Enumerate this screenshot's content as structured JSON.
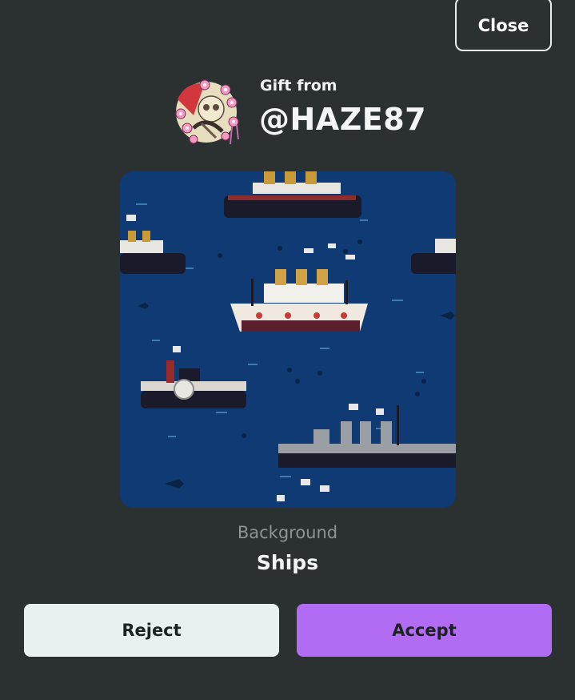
{
  "actions": {
    "close_label": "Close",
    "reject_label": "Reject",
    "accept_label": "Accept"
  },
  "gift": {
    "from_label": "Gift from",
    "sender": "@HAZE87",
    "avatar_icon": "floral-skull-avatar"
  },
  "item": {
    "type": "Background",
    "name": "Ships",
    "preview_icon": "ships-pattern-background"
  },
  "colors": {
    "page_bg": "#2b3030",
    "accept": "#b26cf3",
    "reject": "#e9f0f0",
    "sea": "#0f3a73"
  }
}
